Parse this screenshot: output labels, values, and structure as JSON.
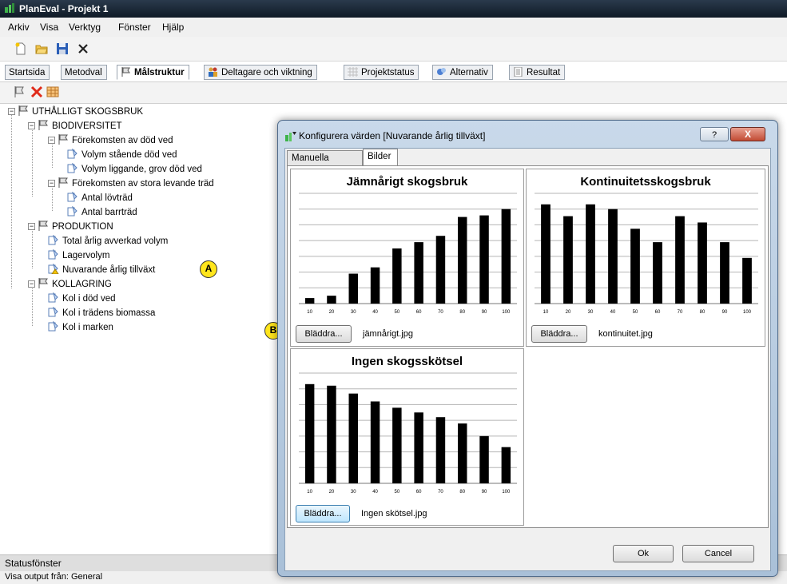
{
  "window": {
    "title": "PlanEval - Projekt 1"
  },
  "menu": [
    "Arkiv",
    "Visa",
    "Verktyg",
    "Fönster",
    "Hjälp"
  ],
  "toolbar": {
    "icons": [
      "new-icon",
      "open-folder-icon",
      "save-icon",
      "close-x-icon"
    ]
  },
  "tabs": [
    {
      "label": "Startsida",
      "icon": "",
      "active": false
    },
    {
      "label": "Metodval",
      "icon": "",
      "active": false
    },
    {
      "label": "Målstruktur",
      "icon": "flag-icon",
      "active": true
    },
    {
      "label": "Deltagare och viktning",
      "icon": "people-icon",
      "active": false
    },
    {
      "label": "Projektstatus",
      "icon": "grid-icon",
      "active": false
    },
    {
      "label": "Alternativ",
      "icon": "gear-people-icon",
      "active": false
    },
    {
      "label": "Resultat",
      "icon": "document-icon",
      "active": false
    }
  ],
  "tree": {
    "nodes": [
      {
        "label": "UTHÅLLIGT SKOGSBRUK"
      },
      {
        "label": "BIODIVERSITET"
      },
      {
        "label": "Förekomsten av död ved"
      },
      {
        "label": "Volym stående död ved"
      },
      {
        "label": "Volym liggande, grov död ved"
      },
      {
        "label": "Förekomsten av stora levande träd"
      },
      {
        "label": "Antal lövträd"
      },
      {
        "label": "Antal barrträd"
      },
      {
        "label": "PRODUKTION"
      },
      {
        "label": "Total årlig avverkad volym"
      },
      {
        "label": "Lagervolym"
      },
      {
        "label": "Nuvarande årlig tillväxt"
      },
      {
        "label": "KOLLAGRING"
      },
      {
        "label": "Kol i död ved"
      },
      {
        "label": "Kol i trädens biomassa"
      },
      {
        "label": "Kol i marken"
      }
    ]
  },
  "callouts": {
    "a": "A",
    "b": "B"
  },
  "status": {
    "header": "Statusfönster",
    "line": "Visa output från:  General"
  },
  "dialog": {
    "title": "Konfigurera värden [Nuvarande årlig tillväxt]",
    "help": "?",
    "close": "X",
    "tabs": [
      "Manuella värden",
      "Bilder"
    ],
    "browse_label": "Bläddra...",
    "ok": "Ok",
    "cancel": "Cancel",
    "panels": [
      {
        "file": "jämnårigt.jpg"
      },
      {
        "file": "kontinuitet.jpg"
      },
      {
        "file": "Ingen skötsel.jpg"
      }
    ]
  },
  "chart_data": [
    {
      "type": "bar",
      "title": "Jämnårigt skogsbruk",
      "categories": [
        "10",
        "20",
        "30",
        "40",
        "50",
        "60",
        "70",
        "80",
        "90",
        "100"
      ],
      "values": [
        7,
        10,
        38,
        46,
        70,
        78,
        86,
        110,
        112,
        120
      ],
      "ylim": [
        0,
        140
      ],
      "grid": true
    },
    {
      "type": "bar",
      "title": "Kontinuitetsskogsbruk",
      "categories": [
        "10",
        "20",
        "30",
        "40",
        "50",
        "60",
        "70",
        "80",
        "90",
        "100"
      ],
      "values": [
        126,
        111,
        126,
        120,
        95,
        78,
        111,
        103,
        78,
        58
      ],
      "ylim": [
        0,
        140
      ],
      "grid": true
    },
    {
      "type": "bar",
      "title": "Ingen skogsskötsel",
      "categories": [
        "10",
        "20",
        "30",
        "40",
        "50",
        "60",
        "70",
        "80",
        "90",
        "100"
      ],
      "values": [
        126,
        124,
        114,
        104,
        96,
        90,
        84,
        76,
        60,
        46
      ],
      "ylim": [
        0,
        140
      ],
      "grid": true
    }
  ]
}
